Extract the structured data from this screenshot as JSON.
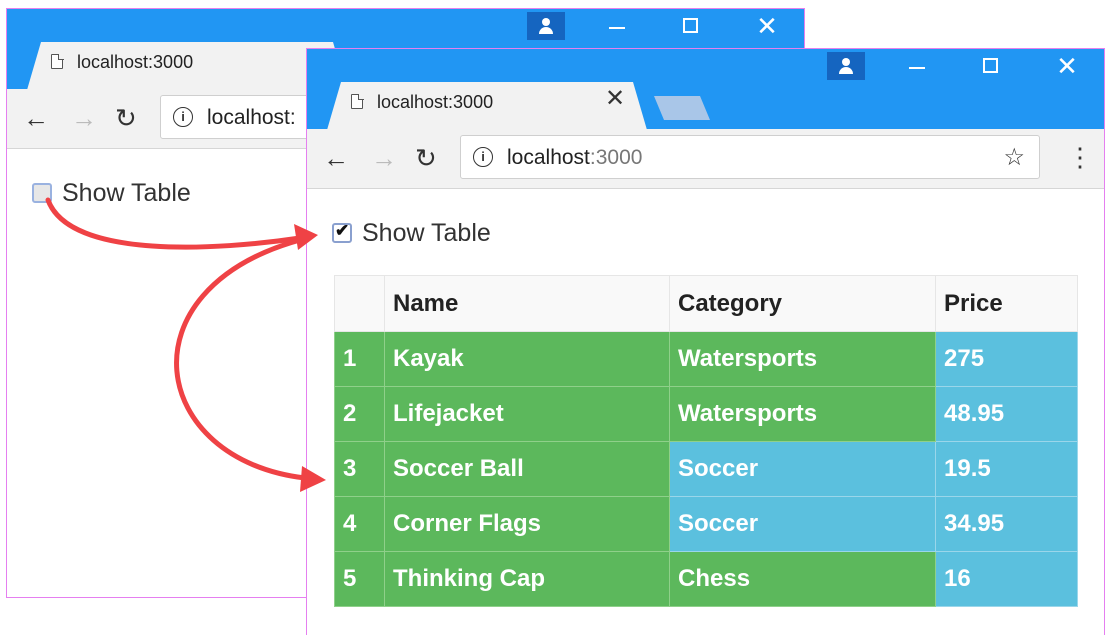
{
  "colors": {
    "titlebar": "#2196f3",
    "window_border": "#e57ff0",
    "success_cell": "#5cb85c",
    "info_cell": "#5bc0de",
    "arrow": "#ef4245"
  },
  "back_window": {
    "tab_title": "localhost:3000",
    "url_text": "localhost:",
    "checkbox_label": "Show Table",
    "checkbox_checked": false
  },
  "front_window": {
    "tab_title": "localhost:3000",
    "url_host": "localhost",
    "url_port": ":3000",
    "checkbox_label": "Show Table",
    "checkbox_checked": true,
    "table": {
      "headers": [
        "",
        "Name",
        "Category",
        "Price"
      ],
      "rows": [
        {
          "index": "1",
          "name": "Kayak",
          "category": "Watersports",
          "price": "275"
        },
        {
          "index": "2",
          "name": "Lifejacket",
          "category": "Watersports",
          "price": "48.95"
        },
        {
          "index": "3",
          "name": "Soccer Ball",
          "category": "Soccer",
          "price": "19.5"
        },
        {
          "index": "4",
          "name": "Corner Flags",
          "category": "Soccer",
          "price": "34.95"
        },
        {
          "index": "5",
          "name": "Thinking Cap",
          "category": "Chess",
          "price": "16"
        }
      ]
    }
  },
  "icons": {
    "tab_page": "page-icon",
    "tab_close": "close-icon",
    "profile": "profile-icon",
    "minimize": "minimize-icon",
    "maximize": "maximize-icon",
    "window_close": "close-icon",
    "back": "back-arrow-icon",
    "forward": "forward-arrow-icon",
    "reload": "reload-icon",
    "info": "info-icon",
    "bookmark": "star-icon",
    "menu": "kebab-menu-icon"
  }
}
